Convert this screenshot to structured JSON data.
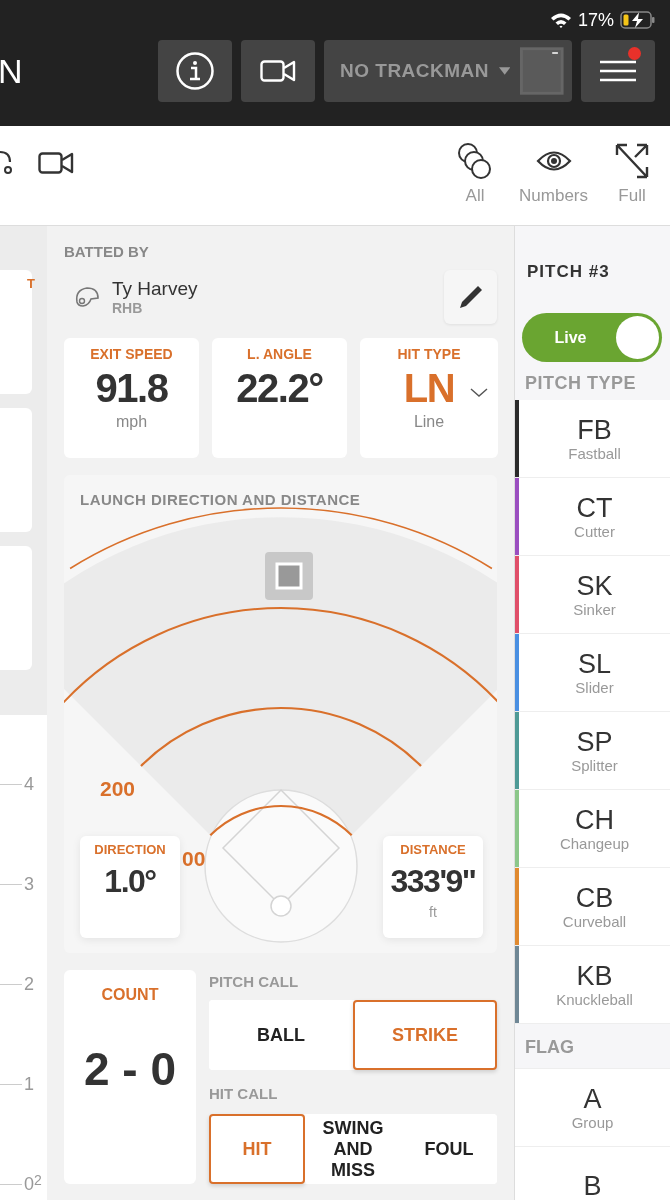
{
  "status_bar": {
    "battery": "17%"
  },
  "header": {
    "logo_fragment": "N",
    "device_select": "NO TRACKMAN",
    "menu_notification": true
  },
  "toolbar": {
    "views": [
      {
        "label": "All",
        "kind": "all"
      },
      {
        "label": "Numbers",
        "kind": "numbers"
      },
      {
        "label": "Full",
        "kind": "full"
      }
    ]
  },
  "left_strip": {
    "card_fragment": "T",
    "axis_ticks": [
      "4",
      "3",
      "2",
      "1",
      "0"
    ],
    "tick_fragment": "2"
  },
  "batted_by": {
    "label": "BATTED BY",
    "name": "Ty Harvey",
    "hand": "RHB"
  },
  "stats": [
    {
      "label": "EXIT SPEED",
      "value": "91.8",
      "unit": "mph",
      "kind": "plain"
    },
    {
      "label": "L. ANGLE",
      "value": "22.2°",
      "kind": "plain"
    },
    {
      "label": "HIT TYPE",
      "value": "LN",
      "unit": "Line",
      "kind": "select"
    }
  ],
  "launch": {
    "title": "LAUNCH DIRECTION AND DISTANCE",
    "distance_labels": [
      "200",
      "00"
    ],
    "direction": {
      "label": "DIRECTION",
      "value": "1.0°"
    },
    "distance": {
      "label": "DISTANCE",
      "value": "333'9\"",
      "unit": "ft"
    }
  },
  "count": {
    "label": "COUNT",
    "value": "2 - 0"
  },
  "pitch_call": {
    "label": "PITCH CALL",
    "options": [
      {
        "label": "BALL",
        "selected": false
      },
      {
        "label": "STRIKE",
        "selected": true
      }
    ]
  },
  "hit_call": {
    "label": "HIT CALL",
    "options": [
      {
        "label": "HIT",
        "selected": true
      },
      {
        "label": "SWING AND MISS",
        "selected": false
      },
      {
        "label": "FOUL",
        "selected": false
      }
    ]
  },
  "sidebar": {
    "title": "PITCH #3",
    "live": {
      "label": "Live",
      "on": true
    },
    "pitch_type_label": "PITCH TYPE",
    "pitch_types": [
      {
        "code": "FB",
        "name": "Fastball",
        "color": "#2b2b2b"
      },
      {
        "code": "CT",
        "name": "Cutter",
        "color": "#9b4fc0"
      },
      {
        "code": "SK",
        "name": "Sinker",
        "color": "#e0506a"
      },
      {
        "code": "SL",
        "name": "Slider",
        "color": "#4a90e2"
      },
      {
        "code": "SP",
        "name": "Splitter",
        "color": "#4e9a96"
      },
      {
        "code": "CH",
        "name": "Changeup",
        "color": "#8cc78a"
      },
      {
        "code": "CB",
        "name": "Curveball",
        "color": "#e08a30"
      },
      {
        "code": "KB",
        "name": "Knuckleball",
        "color": "#6f8795"
      }
    ],
    "flag_label": "FLAG",
    "flags": [
      {
        "code": "A",
        "name": "Group"
      },
      {
        "code": "B"
      }
    ]
  }
}
